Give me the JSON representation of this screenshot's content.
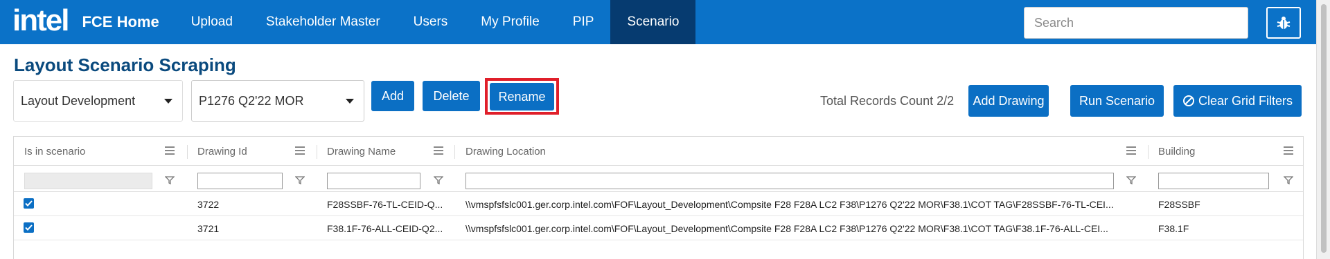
{
  "header": {
    "logo": "intel",
    "app_title": "FCE Home",
    "nav": [
      "Upload",
      "Stakeholder Master",
      "Users",
      "My Profile",
      "PIP",
      "Scenario"
    ],
    "active_nav": "Scenario",
    "search_placeholder": "Search",
    "bug_icon": "bug-icon"
  },
  "page": {
    "title": "Layout Scenario Scraping"
  },
  "toolbar": {
    "layout_select": "Layout Development",
    "scenario_select": "P1276 Q2'22 MOR",
    "add_label": "Add",
    "delete_label": "Delete",
    "rename_label": "Rename",
    "records_count": "Total Records Count 2/2",
    "add_drawing_label": "Add Drawing",
    "run_scenario_label": "Run Scenario",
    "clear_filters_label": "Clear Grid Filters"
  },
  "grid": {
    "columns": [
      "Is in scenario",
      "Drawing Id",
      "Drawing Name",
      "Drawing Location",
      "Building"
    ],
    "rows": [
      {
        "checked": true,
        "id": "3722",
        "name": "F28SSBF-76-TL-CEID-Q...",
        "location": "\\\\vmspfsfslc001.ger.corp.intel.com\\FOF\\Layout_Development\\Compsite F28 F28A LC2 F38\\P1276 Q2'22 MOR\\F38.1\\COT TAG\\F28SSBF-76-TL-CEI...",
        "building": "F28SSBF"
      },
      {
        "checked": true,
        "id": "3721",
        "name": "F38.1F-76-ALL-CEID-Q2...",
        "location": "\\\\vmspfsfslc001.ger.corp.intel.com\\FOF\\Layout_Development\\Compsite F28 F28A LC2 F38\\P1276 Q2'22 MOR\\F38.1\\COT TAG\\F38.1F-76-ALL-CEI...",
        "building": "F38.1F"
      }
    ]
  },
  "colors": {
    "header_bg": "#0b72c8",
    "active_nav_bg": "#063b70",
    "primary_button": "#0b6fc4",
    "title_color": "#0a4a7e",
    "highlight_outline": "#e01f2a"
  }
}
